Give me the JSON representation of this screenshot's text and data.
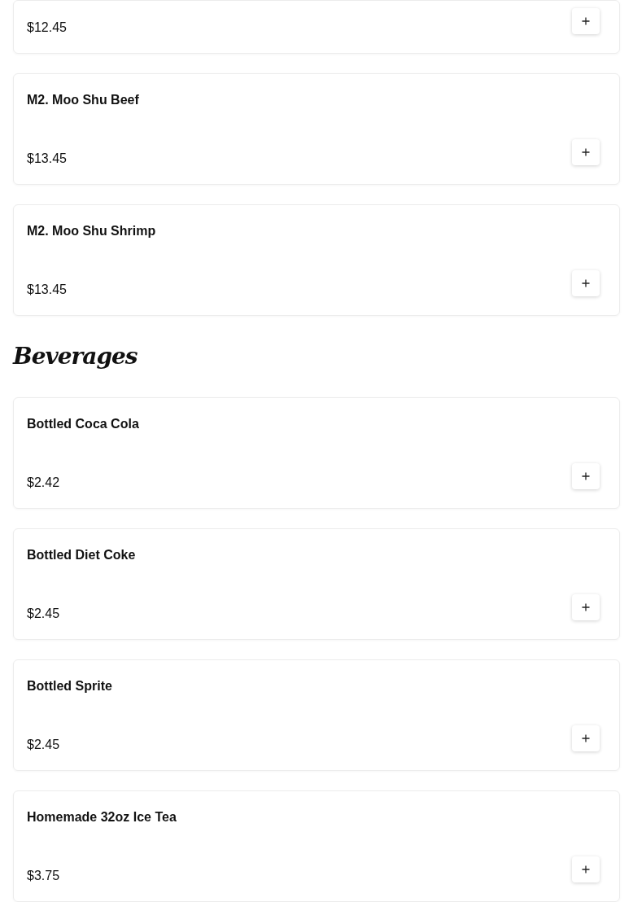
{
  "sections": [
    {
      "items": [
        {
          "price": "$12.45"
        },
        {
          "name": "M2. Moo Shu Beef",
          "price": "$13.45"
        },
        {
          "name": "M2. Moo Shu Shrimp",
          "price": "$13.45"
        }
      ]
    },
    {
      "title": "Beverages",
      "items": [
        {
          "name": "Bottled Coca Cola",
          "price": "$2.42"
        },
        {
          "name": "Bottled Diet Coke",
          "price": "$2.45"
        },
        {
          "name": "Bottled Sprite",
          "price": "$2.45"
        },
        {
          "name": "Homemade 32oz Ice Tea",
          "price": "$3.75"
        }
      ]
    }
  ]
}
